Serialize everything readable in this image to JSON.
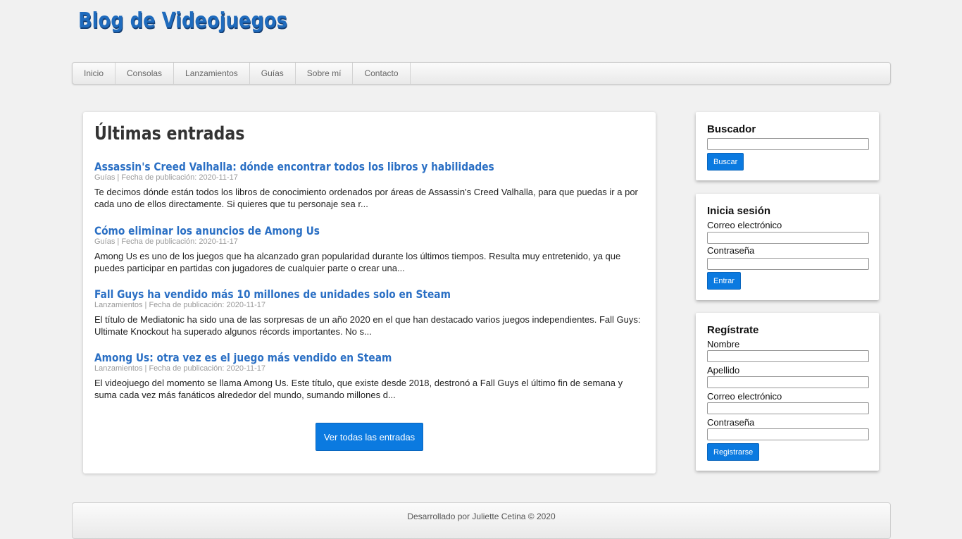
{
  "header": {
    "title": "Blog de Videojuegos"
  },
  "nav": {
    "items": [
      "Inicio",
      "Consolas",
      "Lanzamientos",
      "Guías",
      "Sobre mí",
      "Contacto"
    ]
  },
  "main": {
    "heading": "Últimas entradas",
    "posts": [
      {
        "title": "Assassin's Creed Valhalla: dónde encontrar todos los libros y habilidades",
        "meta": "Guías | Fecha de publicación: 2020-11-17",
        "excerpt": "Te decimos dónde están todos los libros de conocimiento ordenados por áreas de Assassin's Creed Valhalla, para que puedas ir a por cada uno de ellos directamente. Si quieres que tu personaje sea r..."
      },
      {
        "title": "Cómo eliminar los anuncios de Among Us",
        "meta": "Guías | Fecha de publicación: 2020-11-17",
        "excerpt": "Among Us es uno de los juegos que ha alcanzado gran popularidad durante los últimos tiempos. Resulta muy entretenido, ya que puedes participar en partidas con jugadores de cualquier parte o crear una..."
      },
      {
        "title": "Fall Guys ha vendido más 10 millones de unidades solo en Steam",
        "meta": "Lanzamientos | Fecha de publicación: 2020-11-17",
        "excerpt": "El título de Mediatonic ha sido una de las sorpresas de un año 2020 en el que han destacado varios juegos independientes. Fall Guys: Ultimate Knockout ha superado algunos récords importantes. No s..."
      },
      {
        "title": "Among Us: otra vez es el juego más vendido en Steam",
        "meta": "Lanzamientos | Fecha de publicación: 2020-11-17",
        "excerpt": "El videojuego del momento se llama Among Us. Este título, que existe desde 2018, destronó a Fall Guys el último fin de semana y suma cada vez más fanáticos alrededor del mundo, sumando millones d..."
      }
    ],
    "view_all_label": "Ver todas las entradas"
  },
  "sidebar": {
    "search": {
      "title": "Buscador",
      "input_value": "",
      "button_label": "Buscar"
    },
    "login": {
      "title": "Inicia sesión",
      "email_label": "Correo electrónico",
      "password_label": "Contraseña",
      "button_label": "Entrar"
    },
    "register": {
      "title": "Regístrate",
      "name_label": "Nombre",
      "surname_label": "Apellido",
      "email_label": "Correo electrónico",
      "password_label": "Contraseña",
      "button_label": "Registrarse"
    }
  },
  "footer": {
    "text": "Desarrollado por Juliette Cetina © 2020"
  },
  "colors": {
    "accent": "#0b7ae0",
    "link": "#2a6fc4",
    "title": "#1f6bbd"
  }
}
